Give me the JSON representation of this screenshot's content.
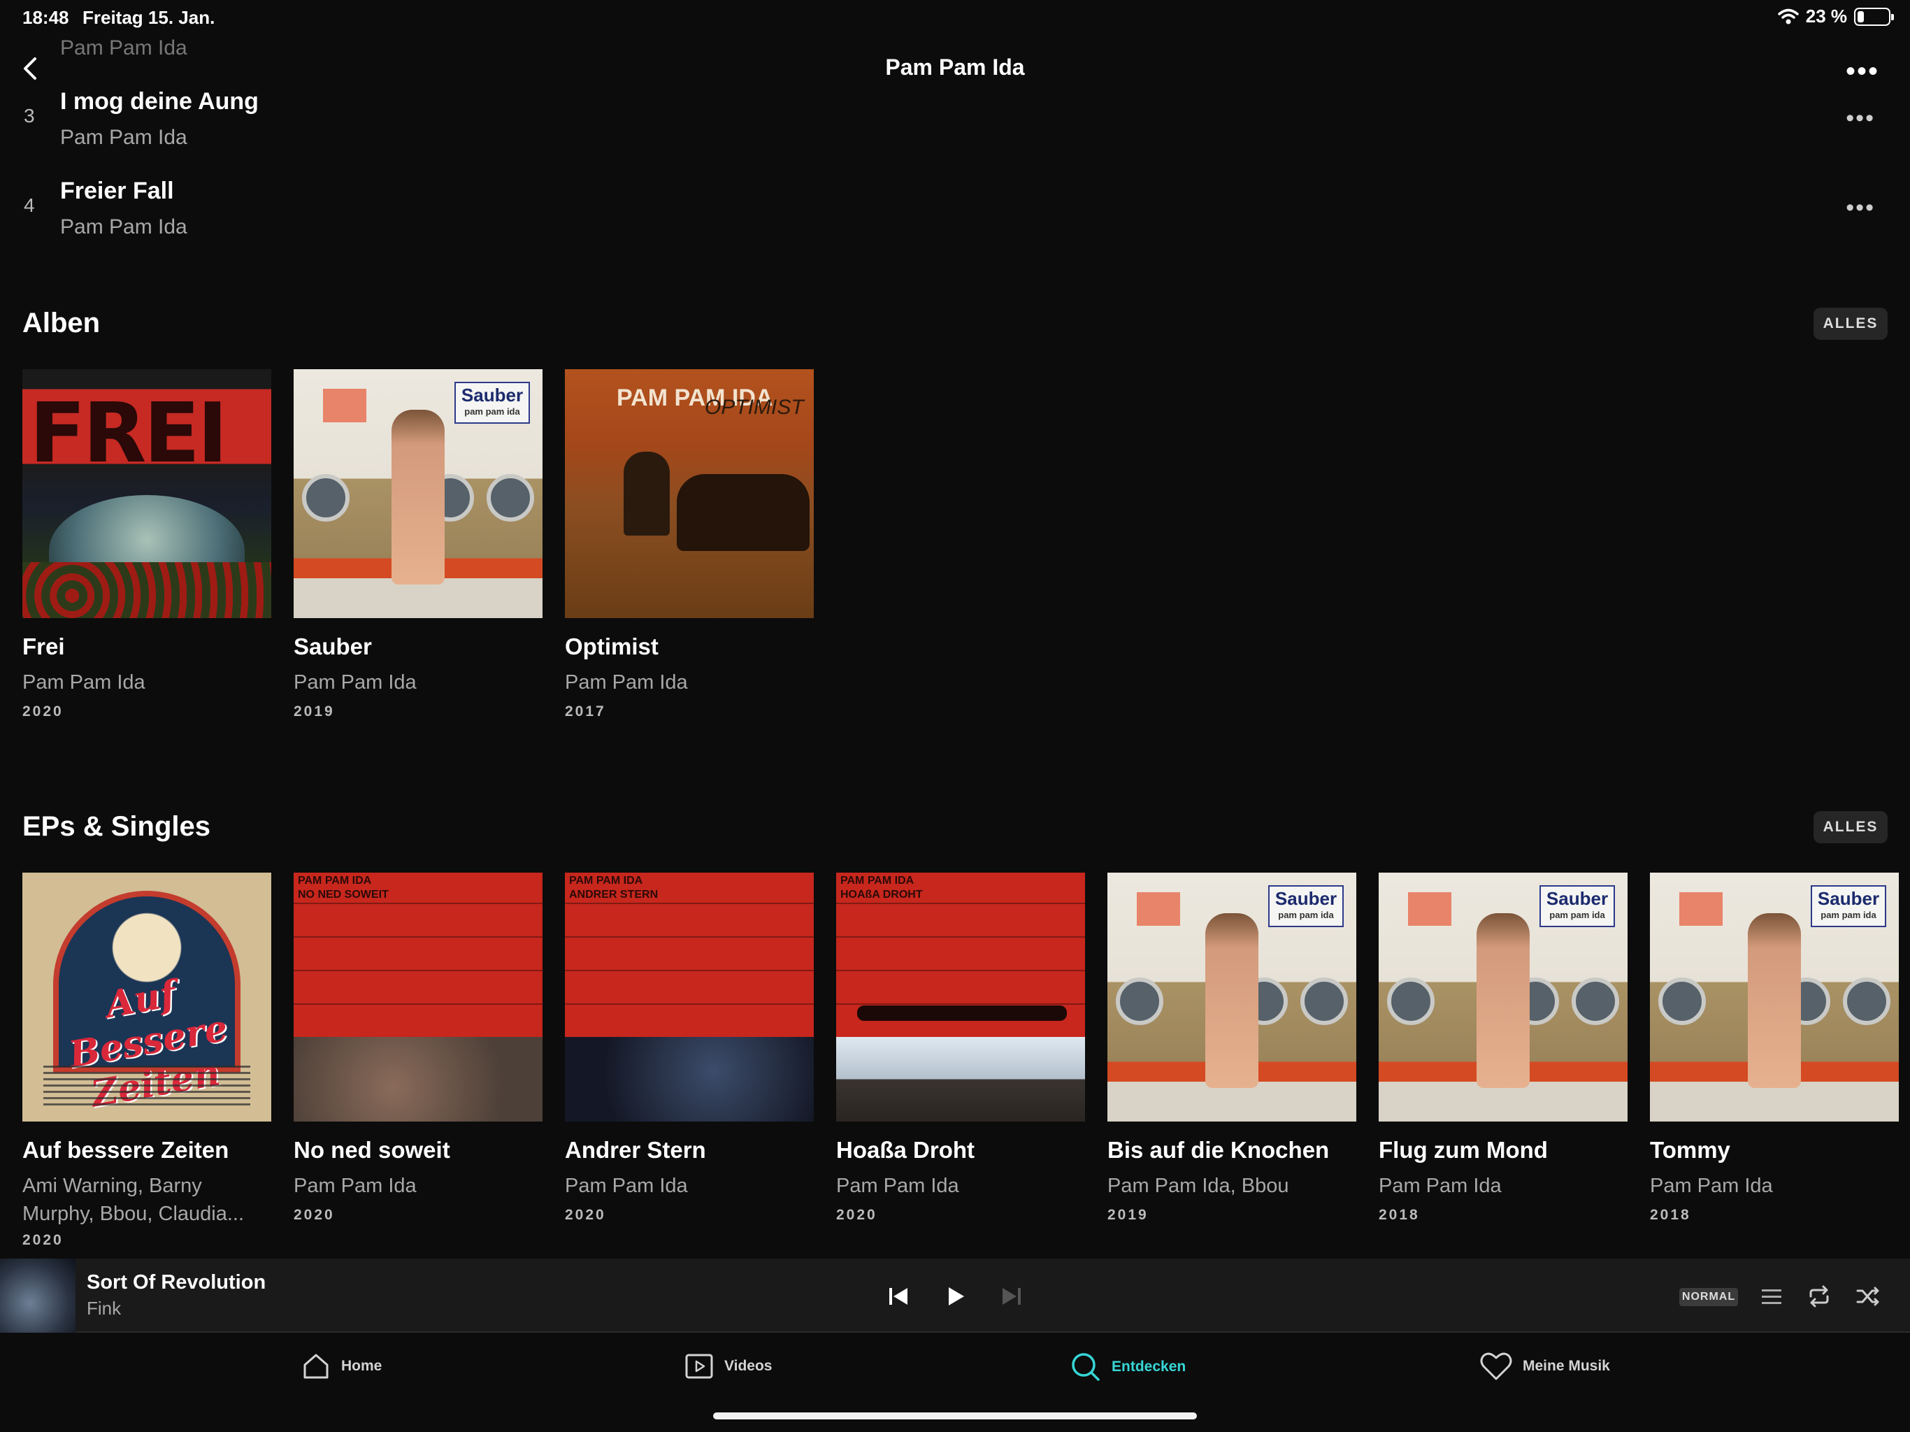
{
  "status": {
    "time": "18:48",
    "date": "Freitag 15. Jan.",
    "battery": "23 %"
  },
  "header": {
    "title": "Pam Pam Ida",
    "partial_artist": "Pam Pam Ida"
  },
  "tracks": [
    {
      "num": "3",
      "title": "I mog deine Aung",
      "artist": "Pam Pam Ida"
    },
    {
      "num": "4",
      "title": "Freier Fall",
      "artist": "Pam Pam Ida"
    }
  ],
  "albums": {
    "title": "Alben",
    "all_label": "ALLES",
    "items": [
      {
        "title": "Frei",
        "artist": "Pam Pam Ida",
        "year": "2020"
      },
      {
        "title": "Sauber",
        "artist": "Pam Pam Ida",
        "year": "2019"
      },
      {
        "title": "Optimist",
        "artist": "Pam Pam Ida",
        "year": "2017"
      }
    ]
  },
  "singles": {
    "title": "EPs & Singles",
    "all_label": "ALLES",
    "items": [
      {
        "title": "Auf bessere Zeiten",
        "artist": "Ami Warning, Barny Murphy, Bbou, Claudia...",
        "year": "2020"
      },
      {
        "title": "No ned soweit",
        "artist": "Pam Pam Ida",
        "year": "2020"
      },
      {
        "title": "Andrer Stern",
        "artist": "Pam Pam Ida",
        "year": "2020"
      },
      {
        "title": "Hoaßa Droht",
        "artist": "Pam Pam Ida",
        "year": "2020"
      },
      {
        "title": "Bis auf die Knochen",
        "artist": "Pam Pam Ida, Bbou",
        "year": "2019"
      },
      {
        "title": "Flug zum Mond",
        "artist": "Pam Pam Ida",
        "year": "2018"
      },
      {
        "title": "Tommy",
        "artist": "Pam Pam Ida",
        "year": "2018"
      }
    ]
  },
  "covers": {
    "frei_text": "FREI",
    "sauber_logo": "Sauber",
    "sauber_sub": "pam pam ida",
    "optimist_band": "PAM PAM IDA",
    "optimist_script": "OPTIMIST",
    "auf_script": "Auf Bessere Zeiten",
    "ned_label": "PAM PAM IDA\nNO NED SOWEIT",
    "stern_label": "PAM PAM IDA\nANDRER STERN",
    "hoassa_label": "PAM PAM IDA\nHOAßA DROHT"
  },
  "player": {
    "song": "Sort Of Revolution",
    "artist": "Fink",
    "quality": "NORMAL"
  },
  "tabs": [
    {
      "label": "Home",
      "icon": "home-icon"
    },
    {
      "label": "Videos",
      "icon": "video-icon"
    },
    {
      "label": "Entdecken",
      "icon": "search-icon",
      "active": true
    },
    {
      "label": "Meine Musik",
      "icon": "heart-icon"
    }
  ],
  "colors": {
    "accent": "#37d6d6",
    "background": "#0c0c0c"
  }
}
